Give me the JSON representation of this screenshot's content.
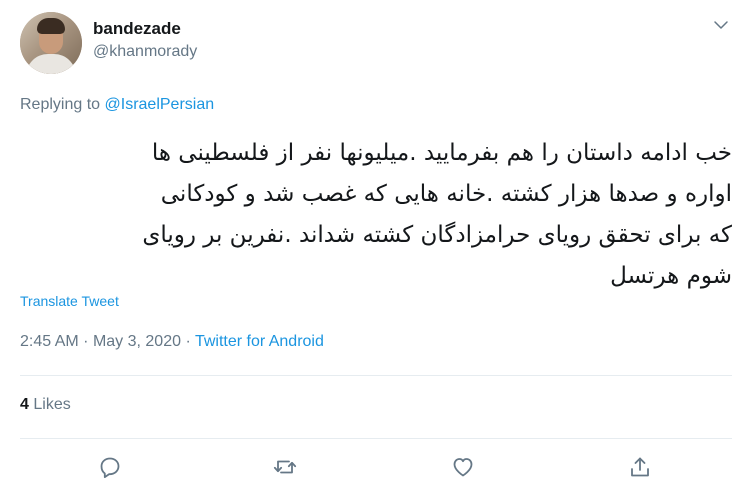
{
  "tweet": {
    "author": {
      "display_name": "bandezade",
      "handle": "@khanmorady"
    },
    "replying_to": {
      "prefix": "Replying to",
      "mention": "@IsraelPersian"
    },
    "text_lines": [
      "خب ادامه داستان را هم بفرمایید .میلیونها نفر از فلسطینی ها",
      "اواره و صدها هزار کشته .خانه هایی که غصب شد و کودکانی",
      "که برای تحقق رویای حرامزادگان کشته شداند .نفرین بر رویای",
      "شوم هرتسل"
    ],
    "translate_label": "Translate Tweet",
    "time": "2:45 AM",
    "date": "May 3, 2020",
    "separator": "·",
    "source": "Twitter for Android",
    "likes_count": "4",
    "likes_label": "Likes"
  },
  "icons": {
    "menu": "chevron-down-icon",
    "reply": "reply-icon",
    "retweet": "retweet-icon",
    "like": "heart-icon",
    "share": "share-icon"
  },
  "colors": {
    "text": "#14171a",
    "secondary": "#657786",
    "link": "#1b95e0",
    "divider": "#e6ecf0"
  }
}
